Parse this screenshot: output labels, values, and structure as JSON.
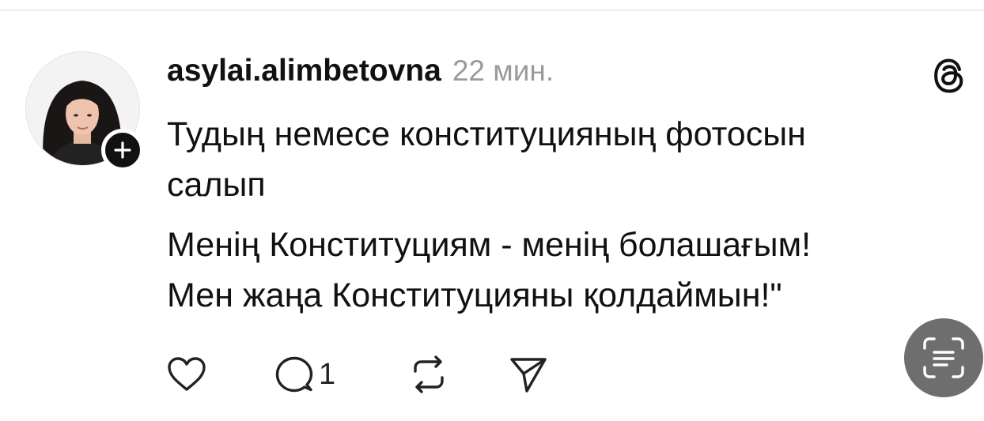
{
  "post": {
    "username": "asylai.alimbetovna",
    "timestamp": "22 мин.",
    "body_lines": [
      "Тудың немесе конституцияның фотосын",
      "салып",
      "Менің Конституциям - менің болашағым!",
      "Мен жаңа Конституцияны қолдаймын!\""
    ],
    "reply_count": "1"
  },
  "icons": {
    "avatar": "profile-photo",
    "follow": "plus-icon",
    "brand": "threads-logo-icon",
    "like": "heart-icon",
    "reply": "comment-icon",
    "repost": "repost-icon",
    "share": "send-icon",
    "scan": "text-scan-icon"
  },
  "colors": {
    "text": "#111111",
    "muted": "#9a9a9a",
    "fab": "#6e6e6e"
  }
}
